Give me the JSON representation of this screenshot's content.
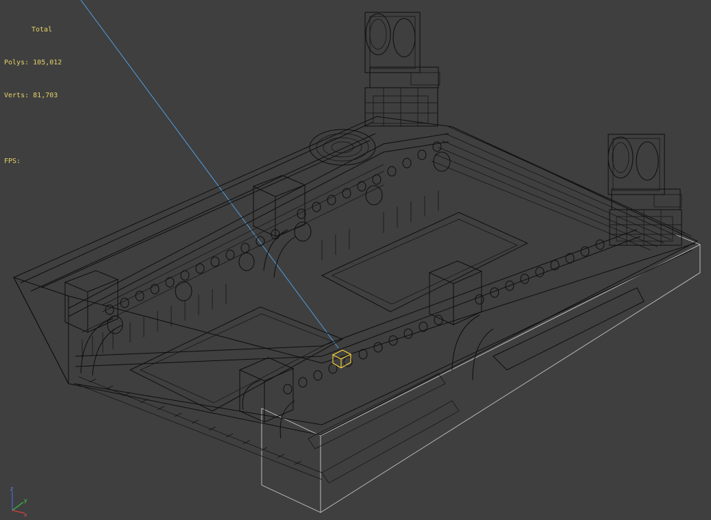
{
  "stats": {
    "title": "Total",
    "polys_label": "Polys:",
    "polys_value": "105,012",
    "verts_label": "Verts:",
    "verts_value": "81,703",
    "fps_label": "FPS:",
    "fps_value": ""
  },
  "axis_gizmo": {
    "x": "x",
    "y": "y",
    "z": "z"
  },
  "colors": {
    "background": "#3f3f3f",
    "wireframe": "#0d0d0d",
    "stats_text": "#e8d36a",
    "selection": "#ffd83a",
    "light_ray": "#4ea0e6",
    "bounding_box": "#c9c9c9"
  }
}
